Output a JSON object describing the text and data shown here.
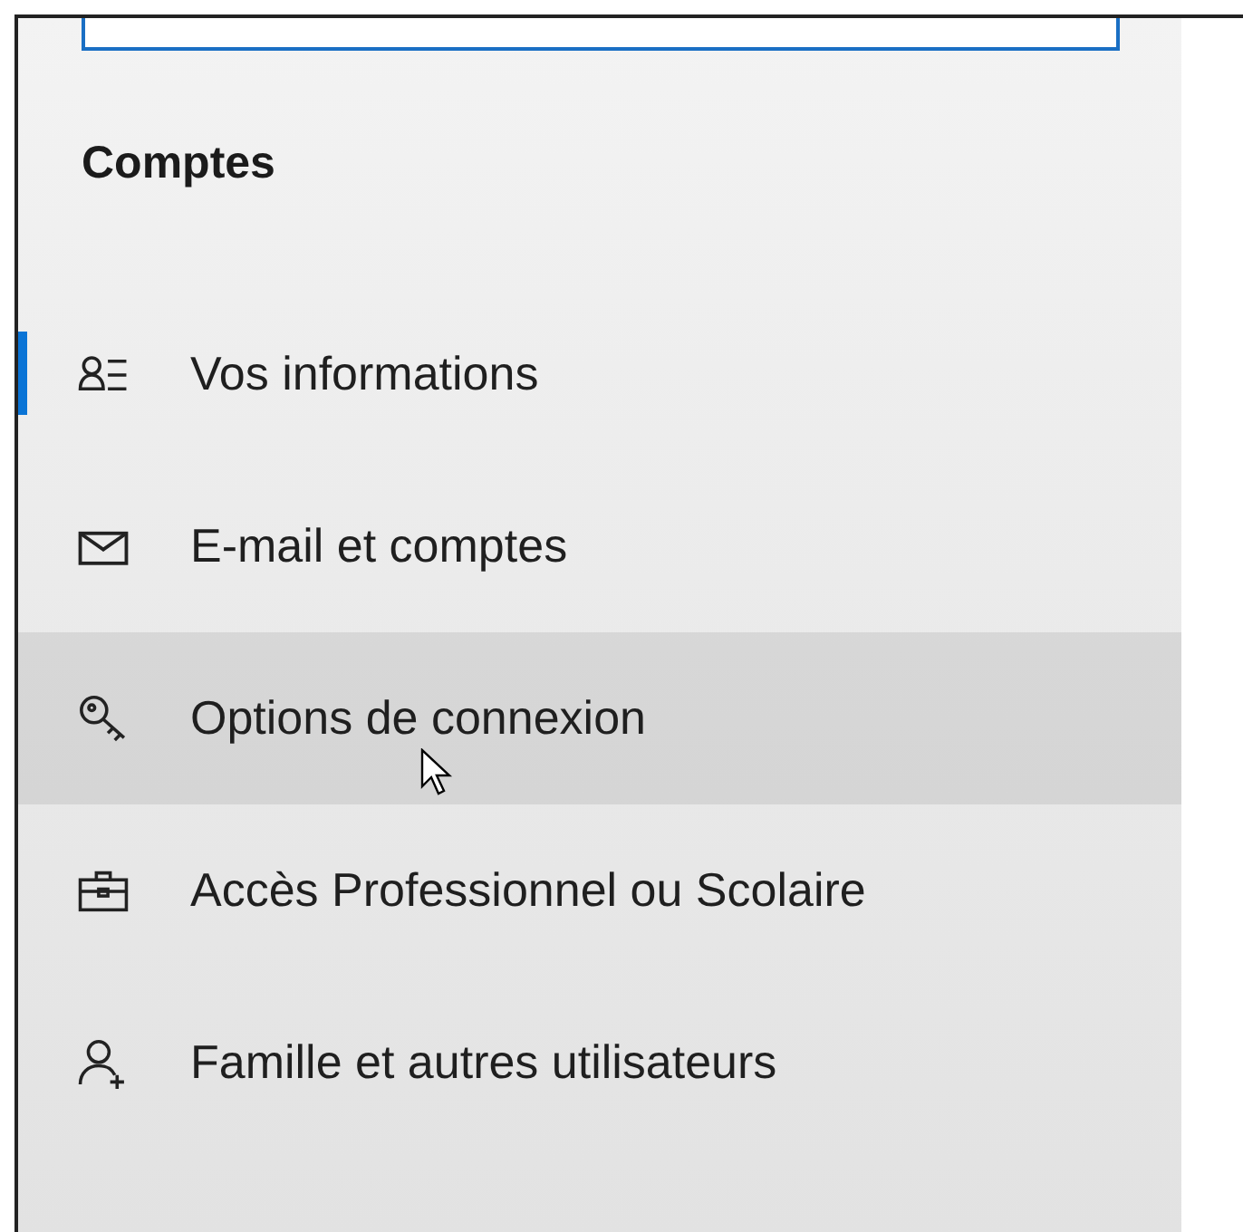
{
  "heading": "Comptes",
  "items": [
    {
      "label": "Vos informations",
      "selected": true,
      "hovered": false
    },
    {
      "label": "E-mail et comptes",
      "selected": false,
      "hovered": false
    },
    {
      "label": "Options de connexion",
      "selected": false,
      "hovered": true
    },
    {
      "label": "Accès Professionnel ou Scolaire",
      "selected": false,
      "hovered": false
    },
    {
      "label": "Famille et autres utilisateurs",
      "selected": false,
      "hovered": false
    }
  ]
}
